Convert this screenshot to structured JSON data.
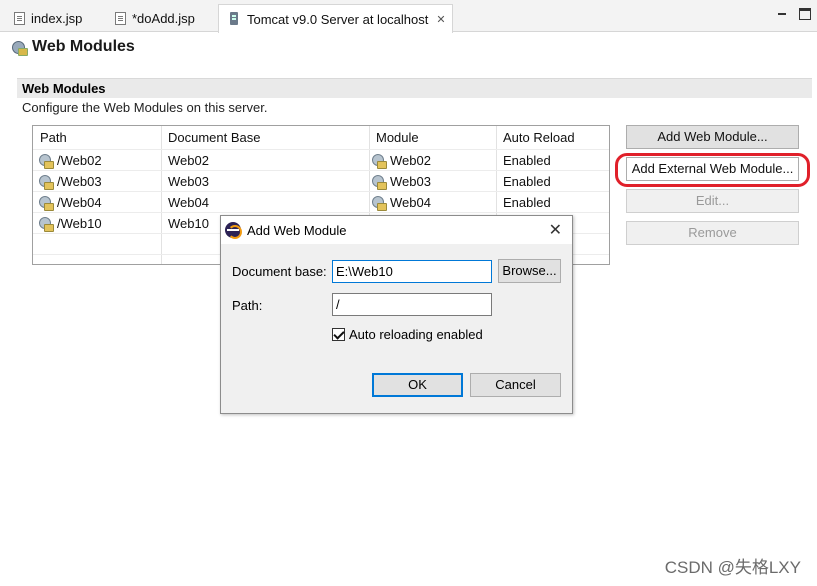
{
  "tabs": [
    {
      "label": "index.jsp"
    },
    {
      "label": "*doAdd.jsp"
    },
    {
      "label": "Tomcat v9.0 Server at localhost",
      "close": "✕"
    }
  ],
  "page": {
    "title": "Web Modules"
  },
  "section": {
    "title": "Web Modules",
    "description": "Configure the Web Modules on this server."
  },
  "table": {
    "headers": {
      "path": "Path",
      "docbase": "Document Base",
      "module": "Module",
      "reload": "Auto Reload"
    },
    "rows": [
      {
        "path": "/Web02",
        "docbase": "Web02",
        "module": "Web02",
        "reload": "Enabled"
      },
      {
        "path": "/Web03",
        "docbase": "Web03",
        "module": "Web03",
        "reload": "Enabled"
      },
      {
        "path": "/Web04",
        "docbase": "Web04",
        "module": "Web04",
        "reload": "Enabled"
      },
      {
        "path": "/Web10",
        "docbase": "Web10",
        "module": "",
        "reload": ""
      }
    ]
  },
  "side_buttons": {
    "add_module": "Add Web Module...",
    "add_external": "Add External Web Module...",
    "edit": "Edit...",
    "remove": "Remove"
  },
  "dialog": {
    "title": "Add Web Module",
    "close": "✕",
    "docbase_label": "Document base:",
    "docbase_value": "E:\\Web10",
    "browse": "Browse...",
    "path_label": "Path:",
    "path_value": "/",
    "auto_reload_label": "Auto reloading enabled",
    "auto_reload_checked": true,
    "ok": "OK",
    "cancel": "Cancel"
  },
  "watermark": "CSDN @失格LXY",
  "colors": {
    "highlight": "#e0202a",
    "focus": "#0078d7"
  },
  "icons": [
    "file-icon",
    "server-icon",
    "web-module-icon",
    "eclipse-icon",
    "close-icon",
    "minimize-icon",
    "maximize-icon",
    "checkbox-checked-icon"
  ]
}
